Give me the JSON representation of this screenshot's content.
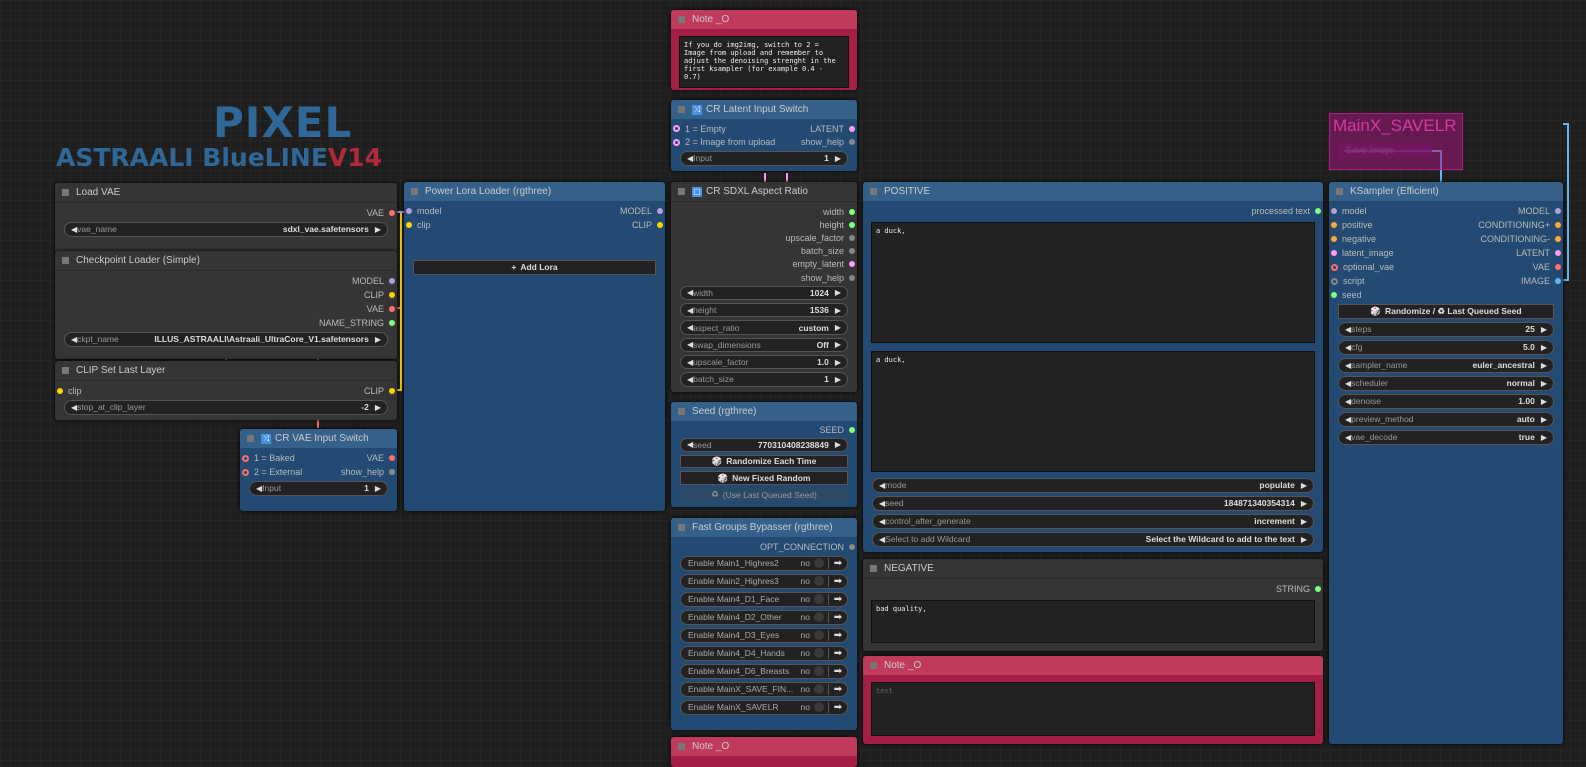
{
  "logo": {
    "line1": "PIXEL",
    "line2_main": "ASTRAALI BlueLINE",
    "line2_version": "V14"
  },
  "group": {
    "title": "MainX_SAVELR",
    "inner_node": "Save Image"
  },
  "nodes": {
    "load_vae": {
      "title": "Load VAE",
      "theme": "gray",
      "rows": [
        {
          "out": {
            "label": "VAE",
            "color": "#ff6e6e"
          }
        }
      ],
      "items": [
        {
          "type": "widget",
          "label": "vae_name",
          "value": "sdxl_vae.safetensors"
        }
      ]
    },
    "checkpoint": {
      "title": "Checkpoint Loader (Simple)",
      "theme": "gray",
      "rows": [
        {
          "out": {
            "label": "MODEL",
            "color": "#b39ddb"
          }
        },
        {
          "out": {
            "label": "CLIP",
            "color": "#ffd500"
          }
        },
        {
          "out": {
            "label": "VAE",
            "color": "#ff6e6e"
          }
        },
        {
          "out": {
            "label": "NAME_STRING",
            "color": "#7eff7e"
          }
        }
      ],
      "items": [
        {
          "type": "widget",
          "label": "ckpt_name",
          "value": "ILLUS_ASTRAALI\\Astraali_UltraCore_V1.safetensors"
        }
      ]
    },
    "clip_set": {
      "title": "CLIP Set Last Layer",
      "theme": "gray",
      "rows": [
        {
          "in": {
            "label": "clip",
            "color": "#ffd500"
          },
          "out": {
            "label": "CLIP",
            "color": "#ffd500"
          }
        }
      ],
      "items": [
        {
          "type": "widget",
          "label": "stop_at_clip_layer",
          "value": "-2"
        }
      ]
    },
    "vae_switch": {
      "title": "CR VAE Input Switch",
      "theme": "blue",
      "icon": "switch",
      "rows": [
        {
          "in": {
            "label": "1 = Baked",
            "color": "#ff6e6e",
            "ring": true
          },
          "out": {
            "label": "VAE",
            "color": "#ff6e6e"
          }
        },
        {
          "in": {
            "label": "2 = External",
            "color": "#ff6e6e",
            "ring": true
          },
          "out": {
            "label": "show_help",
            "color": "#888"
          }
        }
      ],
      "items": [
        {
          "type": "widget",
          "label": "Input",
          "value": "1"
        }
      ]
    },
    "lora": {
      "title": "Power Lora Loader (rgthree)",
      "theme": "blue",
      "rows": [
        {
          "in": {
            "label": "model",
            "color": "#b39ddb"
          },
          "out": {
            "label": "MODEL",
            "color": "#b39ddb"
          }
        },
        {
          "in": {
            "label": "clip",
            "color": "#ffd500"
          },
          "out": {
            "label": "CLIP",
            "color": "#ffd500"
          }
        }
      ],
      "items": [
        {
          "type": "spacer"
        },
        {
          "type": "button",
          "label": "Add Lora",
          "icon": "plus"
        }
      ]
    },
    "note1": {
      "title": "Note _O",
      "theme": "pink",
      "items": [
        {
          "type": "text",
          "value": "If you do img2img, switch to 2 = Image from upload and remember to adjust the denoising strenght in the first ksampler (for example 0.4 - 0.7)"
        }
      ]
    },
    "latent_switch": {
      "title": "CR Latent Input Switch",
      "theme": "blue",
      "icon": "switch",
      "rows": [
        {
          "in": {
            "label": "1 = Empty",
            "color": "#ff9cf9",
            "ring": true
          },
          "out": {
            "label": "LATENT",
            "color": "#ff9cf9"
          }
        },
        {
          "in": {
            "label": "2 = Image from upload",
            "color": "#ff9cf9",
            "ring": true
          },
          "out": {
            "label": "show_help",
            "color": "#888"
          }
        }
      ],
      "items": [
        {
          "type": "widget",
          "label": "Input",
          "value": "1"
        }
      ]
    },
    "aspect": {
      "title": "CR SDXL Aspect Ratio",
      "theme": "gray",
      "icon": "aspect",
      "rows": [
        {
          "out": {
            "label": "width",
            "color": "#7eff7e"
          }
        },
        {
          "out": {
            "label": "height",
            "color": "#7eff7e"
          }
        },
        {
          "out": {
            "label": "upscale_factor",
            "color": "#888"
          }
        },
        {
          "out": {
            "label": "batch_size",
            "color": "#888"
          }
        },
        {
          "out": {
            "label": "empty_latent",
            "color": "#ff9cf9"
          }
        },
        {
          "out": {
            "label": "show_help",
            "color": "#888"
          }
        }
      ],
      "items": [
        {
          "type": "widget",
          "label": "width",
          "value": "1024"
        },
        {
          "type": "widget",
          "label": "height",
          "value": "1536"
        },
        {
          "type": "widget",
          "label": "aspect_ratio",
          "value": "custom"
        },
        {
          "type": "widget",
          "label": "swap_dimensions",
          "value": "Off"
        },
        {
          "type": "widget",
          "label": "upscale_factor",
          "value": "1.0"
        },
        {
          "type": "widget",
          "label": "batch_size",
          "value": "1"
        }
      ]
    },
    "seed": {
      "title": "Seed (rgthree)",
      "theme": "blue",
      "rows": [
        {
          "out": {
            "label": "SEED",
            "color": "#7eff7e"
          }
        }
      ],
      "items": [
        {
          "type": "widget",
          "label": "seed",
          "value": "770310408238849"
        },
        {
          "type": "button",
          "label": "Randomize Each Time",
          "icon": "dice"
        },
        {
          "type": "button",
          "label": "New Fixed Random",
          "icon": "dice"
        },
        {
          "type": "button",
          "label": "(Use Last Queued Seed)",
          "icon": "recycle",
          "disabled": true
        }
      ]
    },
    "fgb": {
      "title": "Fast Groups Bypasser (rgthree)",
      "theme": "blue",
      "rows": [
        {
          "out": {
            "label": "OPT_CONNECTION",
            "color": "#888"
          }
        }
      ],
      "items": [
        {
          "type": "toggle",
          "label": "Enable Main1_Highres2",
          "value": "no"
        },
        {
          "type": "toggle",
          "label": "Enable Main2_Highres3",
          "value": "no"
        },
        {
          "type": "toggle",
          "label": "Enable Main4_D1_Face",
          "value": "no"
        },
        {
          "type": "toggle",
          "label": "Enable Main4_D2_Other",
          "value": "no"
        },
        {
          "type": "toggle",
          "label": "Enable Main4_D3_Eyes",
          "value": "no"
        },
        {
          "type": "toggle",
          "label": "Enable Main4_D4_Hands",
          "value": "no"
        },
        {
          "type": "toggle",
          "label": "Enable Main4_D6_Breasts",
          "value": "no"
        },
        {
          "type": "toggle",
          "label": "Enable MainX_SAVE_FIN...",
          "value": "no"
        },
        {
          "type": "toggle",
          "label": "Enable MainX_SAVELR",
          "value": "no"
        }
      ]
    },
    "note3": {
      "title": "Note _O",
      "theme": "pink",
      "items": []
    },
    "positive": {
      "title": "POSITIVE",
      "theme": "blue",
      "rows": [
        {
          "out": {
            "label": "processed text",
            "color": "#7eff7e"
          }
        }
      ],
      "items": [
        {
          "type": "text",
          "value": "a duck,"
        },
        {
          "type": "text",
          "value": "a duck,"
        },
        {
          "type": "widget",
          "label": "mode",
          "value": "populate"
        },
        {
          "type": "widget",
          "label": "seed",
          "value": "184871340354314"
        },
        {
          "type": "widget",
          "label": "control_after_generate",
          "value": "increment"
        },
        {
          "type": "widget",
          "label": "Select to add Wildcard",
          "value": "Select the Wildcard to add to the text"
        }
      ]
    },
    "negative": {
      "title": "NEGATIVE",
      "theme": "gray",
      "rows": [
        {
          "out": {
            "label": "STRING",
            "color": "#7eff7e"
          }
        }
      ],
      "items": [
        {
          "type": "text",
          "value": "bad quality,"
        }
      ]
    },
    "note2": {
      "title": "Note _O",
      "theme": "pink",
      "items": [
        {
          "type": "text",
          "value": "",
          "placeholder": "text"
        }
      ]
    },
    "ksampler": {
      "title": "KSampler (Efficient)",
      "theme": "blue",
      "rows": [
        {
          "in": {
            "label": "model",
            "color": "#b39ddb"
          },
          "out": {
            "label": "MODEL",
            "color": "#b39ddb"
          }
        },
        {
          "in": {
            "label": "positive",
            "color": "#ffa931"
          },
          "out": {
            "label": "CONDITIONING+",
            "color": "#ffa931"
          }
        },
        {
          "in": {
            "label": "negative",
            "color": "#ffa931"
          },
          "out": {
            "label": "CONDITIONING-",
            "color": "#ffa931"
          }
        },
        {
          "in": {
            "label": "latent_image",
            "color": "#ff9cf9"
          },
          "out": {
            "label": "LATENT",
            "color": "#ff9cf9"
          }
        },
        {
          "in": {
            "label": "optional_vae",
            "color": "#ff6e6e",
            "ring": true
          },
          "out": {
            "label": "VAE",
            "color": "#ff6e6e"
          }
        },
        {
          "in": {
            "label": "script",
            "color": "#888",
            "ring": true
          },
          "out": {
            "label": "IMAGE",
            "color": "#64b5f6"
          }
        },
        {
          "in": {
            "label": "seed",
            "color": "#7eff7e"
          }
        }
      ],
      "items": [
        {
          "type": "button",
          "label": "Randomize / ♻ Last Queued Seed",
          "icon": "dice"
        },
        {
          "type": "widget",
          "label": "steps",
          "value": "25"
        },
        {
          "type": "widget",
          "label": "cfg",
          "value": "5.0"
        },
        {
          "type": "widget",
          "label": "sampler_name",
          "value": "euler_ancestral"
        },
        {
          "type": "widget",
          "label": "scheduler",
          "value": "normal"
        },
        {
          "type": "widget",
          "label": "denoise",
          "value": "1.00"
        },
        {
          "type": "widget",
          "label": "preview_method",
          "value": "auto"
        },
        {
          "type": "widget",
          "label": "vae_decode",
          "value": "true"
        }
      ]
    }
  }
}
